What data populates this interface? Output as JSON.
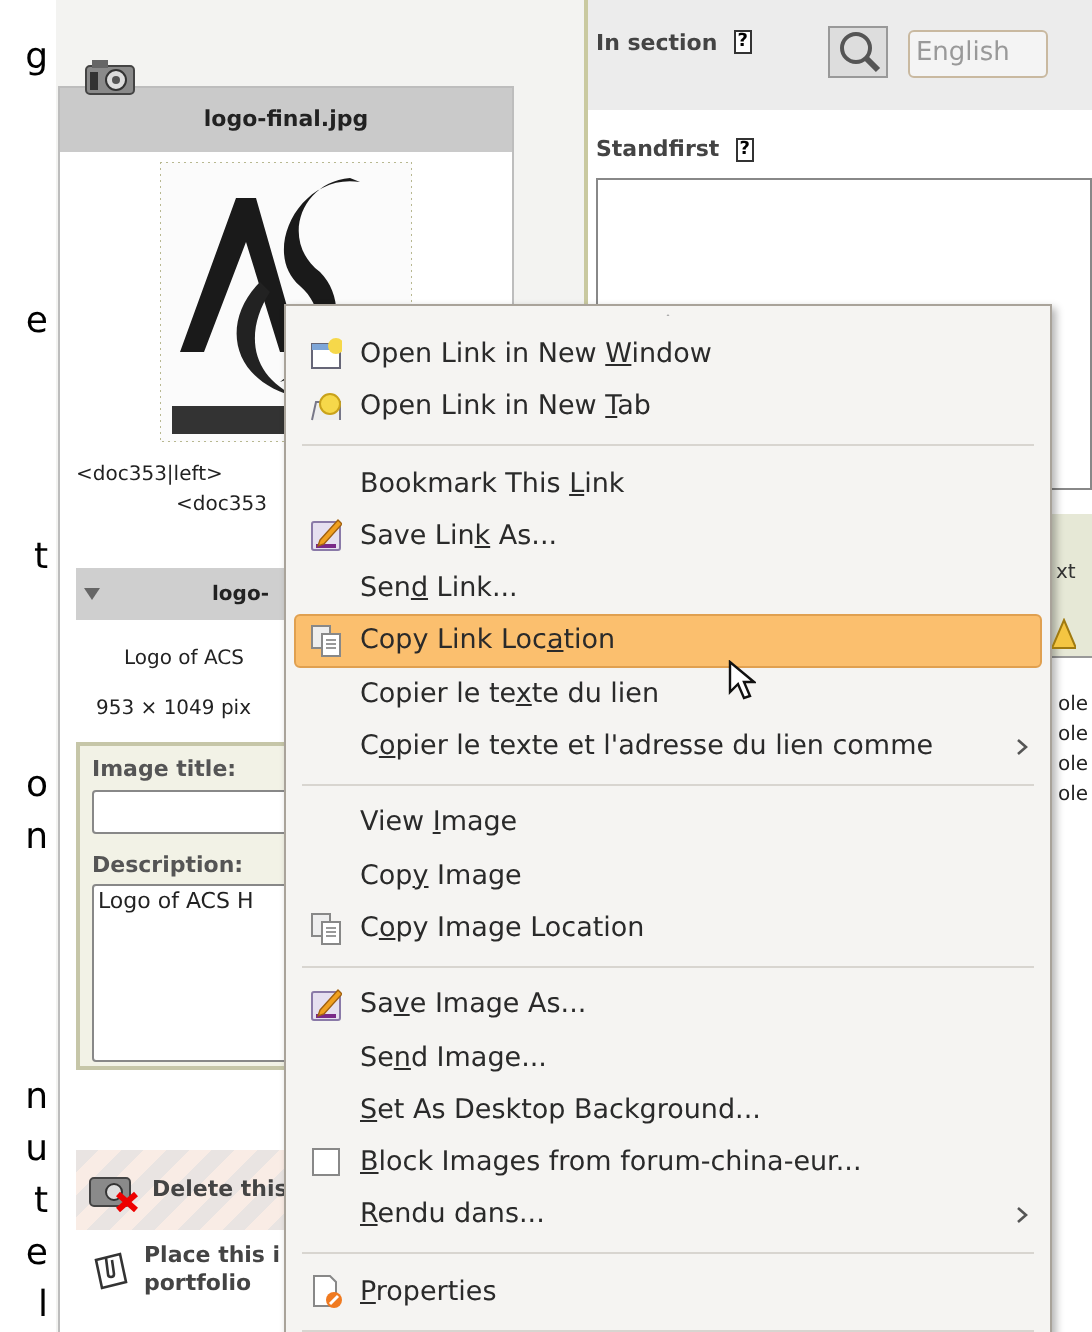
{
  "edge_text": [
    "g",
    "e",
    "t",
    "o",
    "n",
    "n",
    "u",
    "t",
    "e",
    "l"
  ],
  "image_card": {
    "title": "logo-final.jpg",
    "codes": [
      "<doc353|left>",
      "<doc353"
    ]
  },
  "details": {
    "expanded": true,
    "title": "logo-",
    "caption": "Logo of ACS",
    "dimensions": "953 × 1049 pix"
  },
  "form": {
    "image_title": {
      "label": "Image title:"
    },
    "description": {
      "label": "Description:",
      "value": "Logo of ACS H"
    }
  },
  "actions": [
    {
      "kind": "delete",
      "lines": [
        "Delete this"
      ]
    },
    {
      "kind": "place",
      "lines": [
        "Place this i",
        "portfolio"
      ]
    }
  ],
  "section": {
    "label": "In section",
    "help": "?",
    "language": "English"
  },
  "standfirst": {
    "label": "Standfirst",
    "help": "?"
  },
  "side_panel": {
    "header": "xt",
    "lines": [
      "ole",
      "ole",
      "ole",
      "ole"
    ]
  },
  "menu": {
    "items": [
      {
        "kind": "item",
        "label": {
          "before": "Open Link in New ",
          "key": "W",
          "after": "indow"
        },
        "selected": false
      },
      {
        "kind": "item",
        "label": {
          "before": "Open Link in New ",
          "key": "T",
          "after": "ab"
        },
        "selected": false
      },
      {
        "kind": "separator"
      },
      {
        "kind": "item",
        "label": {
          "before": "Bookmark This ",
          "key": "L",
          "after": "ink"
        },
        "selected": false
      },
      {
        "kind": "item",
        "label": {
          "before": "Save Lin",
          "key": "k",
          "after": " As..."
        },
        "selected": false
      },
      {
        "kind": "item",
        "label": {
          "before": "Sen",
          "key": "d",
          "after": " Link..."
        },
        "selected": false
      },
      {
        "kind": "item",
        "label": {
          "before": "Copy Link Loc",
          "key": "a",
          "after": "tion"
        },
        "selected": true
      },
      {
        "kind": "item",
        "label": {
          "before": "Copier le te",
          "key": "x",
          "after": "te du lien"
        },
        "selected": false
      },
      {
        "kind": "item",
        "label": {
          "before": "C",
          "key": "o",
          "after": "pier le texte et l'adresse du lien comme"
        },
        "submenu": true,
        "selected": false
      },
      {
        "kind": "separator"
      },
      {
        "kind": "item",
        "label": {
          "before": "View ",
          "key": "I",
          "after": "mage"
        },
        "selected": false
      },
      {
        "kind": "item",
        "label": {
          "before": "Cop",
          "key": "y",
          "after": " Image"
        },
        "selected": false
      },
      {
        "kind": "item",
        "label": {
          "before": "C",
          "key": "o",
          "after": "py Image Location"
        },
        "selected": false
      },
      {
        "kind": "separator"
      },
      {
        "kind": "item",
        "label": {
          "before": "Sa",
          "key": "v",
          "after": "e Image As..."
        },
        "selected": false
      },
      {
        "kind": "item",
        "label": {
          "before": "Se",
          "key": "n",
          "after": "d Image..."
        },
        "selected": false
      },
      {
        "kind": "item",
        "label": {
          "key": "S",
          "after": "et As Desktop Background..."
        },
        "selected": false
      },
      {
        "kind": "check",
        "checked": false,
        "label": {
          "key": "B",
          "after": "lock Images from forum-china-eur..."
        },
        "selected": false
      },
      {
        "kind": "item",
        "label": {
          "key": "R",
          "after": "endu dans..."
        },
        "submenu": true,
        "selected": false
      },
      {
        "kind": "separator"
      },
      {
        "kind": "item",
        "label": {
          "key": "P",
          "after": "roperties"
        },
        "selected": false
      },
      {
        "kind": "separator"
      }
    ]
  }
}
